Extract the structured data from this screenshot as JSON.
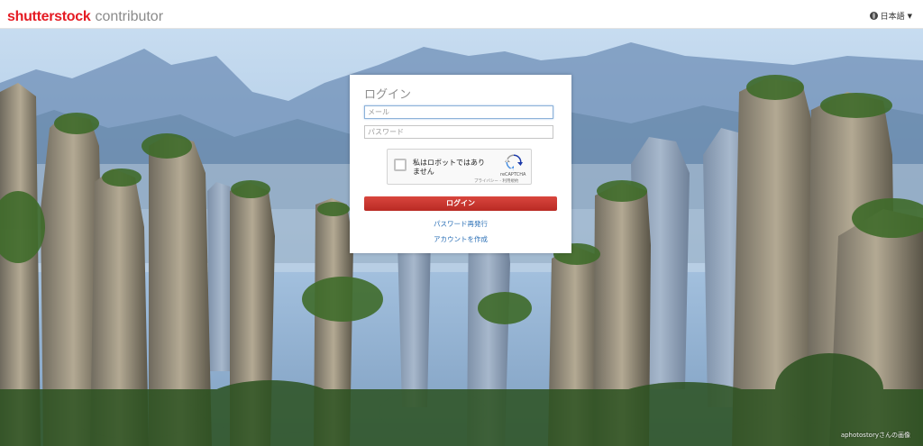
{
  "header": {
    "brand": "shutterstock",
    "sub": "contributor",
    "language": "日本語"
  },
  "login": {
    "title": "ログイン",
    "email_placeholder": "メール",
    "password_placeholder": "パスワード",
    "captcha": {
      "label": "私はロボットではありません",
      "brand": "reCAPTCHA",
      "links": "プライバシー - 利用規約"
    },
    "submit_label": "ログイン",
    "reset_link": "パスワード再発行",
    "create_link": "アカウントを作成"
  },
  "footer": {
    "credit": "aphotostoryさんの画像"
  },
  "colors": {
    "brand_red": "#e51b23",
    "button_red": "#c9302c",
    "link_blue": "#2a6fb6",
    "sky": "#bcd8f0"
  },
  "icons": {
    "globe": "globe-icon",
    "caret": "caret-down-icon",
    "recaptcha": "recaptcha-icon"
  }
}
